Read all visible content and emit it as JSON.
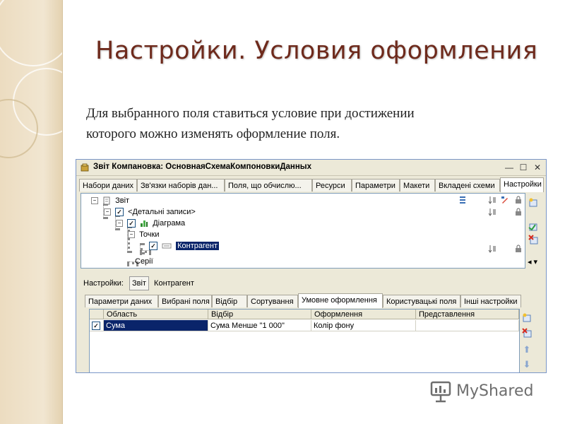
{
  "slide": {
    "title": "Настройки. Условия оформления",
    "description_line1": "Для выбранного поля ставиться условие при достижении",
    "description_line2": "которого можно изменять оформление поля."
  },
  "window": {
    "title": "Звіт Компановка: ОсновнаяСхемаКомпоновкиДанных",
    "controls": {
      "minimize": "—",
      "maximize": "☐",
      "close": "✕"
    },
    "tabs": [
      "Набори даних",
      "Зв'язки наборів дан...",
      "Поля, що обчислю...",
      "Ресурси",
      "Параметри",
      "Макети",
      "Вкладені схеми",
      "Настройки"
    ],
    "active_tab": "Настройки",
    "tree": {
      "root": "Звіт",
      "detail": "<Детальні записи>",
      "diagram": "Діаграма",
      "points": "Точки",
      "counterparty": "Контрагент",
      "series": "Серії"
    },
    "settings_row": {
      "label": "Настройки:",
      "button": "Звіт",
      "value": "Контрагент"
    },
    "subtabs": [
      "Параметри даних",
      "Вибрані поля",
      "Відбір",
      "Сортування",
      "Умовне оформлення",
      "Користувацькі поля",
      "Інші настройки"
    ],
    "active_subtab": "Умовне оформлення",
    "grid": {
      "columns": [
        "Область",
        "Відбір",
        "Оформлення",
        "Представлення"
      ],
      "rows": [
        {
          "checked": true,
          "area": "Сума",
          "filter": "Сума Менше \"1 000\"",
          "format": "Колір фону",
          "presentation": ""
        }
      ]
    }
  },
  "watermark": {
    "text": "MyShared"
  },
  "colors": {
    "title": "#6e2a1c",
    "selection": "#0a246a",
    "window_bg": "#ece9d8",
    "sidebar": "#ecdcc0"
  }
}
